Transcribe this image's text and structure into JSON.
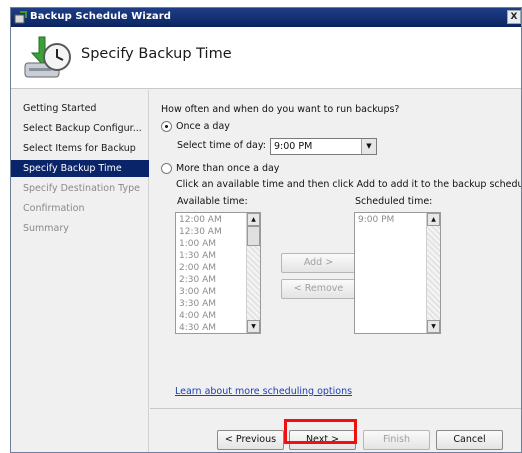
{
  "window": {
    "title": "Backup Schedule Wizard",
    "close_glyph": "X"
  },
  "header": {
    "title": "Specify Backup Time",
    "icon": "backup-clock-icon"
  },
  "nav": {
    "items": [
      {
        "label": "Getting Started",
        "state": "normal"
      },
      {
        "label": "Select Backup Configur...",
        "state": "normal"
      },
      {
        "label": "Select Items for Backup",
        "state": "normal"
      },
      {
        "label": "Specify Backup Time",
        "state": "active"
      },
      {
        "label": "Specify Destination Type",
        "state": "dim"
      },
      {
        "label": "Confirmation",
        "state": "dim"
      },
      {
        "label": "Summary",
        "state": "dim"
      }
    ]
  },
  "main": {
    "question": "How often and when do you want to run backups?",
    "once_label": "Once a day",
    "once_selected": true,
    "time_label": "Select time of day:",
    "time_value": "9:00 PM",
    "more_label": "More than once a day",
    "more_selected": false,
    "instructions": "Click an available time and then click Add to add it to the backup schedule.",
    "available_label": "Available time:",
    "scheduled_label": "Scheduled time:",
    "available_times": [
      "12:00 AM",
      "12:30 AM",
      "1:00 AM",
      "1:30 AM",
      "2:00 AM",
      "2:30 AM",
      "3:00 AM",
      "3:30 AM",
      "4:00 AM",
      "4:30 AM"
    ],
    "scheduled_times": [
      "9:00 PM"
    ],
    "add_label": "Add >",
    "remove_label": "< Remove",
    "learn_link": "Learn about more scheduling options"
  },
  "footer": {
    "previous_label": "< Previous",
    "next_label": "Next >",
    "finish_label": "Finish",
    "cancel_label": "Cancel"
  },
  "colors": {
    "title_bar": "#0b2461",
    "active_nav": "#0a246a",
    "highlight": "#ee1111",
    "link": "#1a3fb4"
  }
}
